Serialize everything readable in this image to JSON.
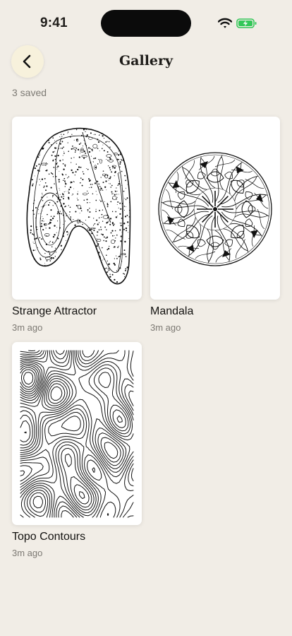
{
  "status": {
    "time": "9:41",
    "icons": [
      "wifi-icon",
      "battery-charging-icon"
    ],
    "battery_color": "#34c759"
  },
  "header": {
    "back_icon": "chevron-left-icon",
    "title": "Gallery"
  },
  "gallery": {
    "count_label": "3 saved",
    "items": [
      {
        "title": "Strange Attractor",
        "time": "3m ago",
        "art": "strange-attractor"
      },
      {
        "title": "Mandala",
        "time": "3m ago",
        "art": "mandala"
      },
      {
        "title": "Topo Contours",
        "time": "3m ago",
        "art": "topo-contours"
      }
    ]
  },
  "colors": {
    "background": "#f1ede6",
    "card": "#ffffff",
    "ink": "#111111",
    "muted": "#7d7a74",
    "back_button": "#f7f1dc"
  }
}
